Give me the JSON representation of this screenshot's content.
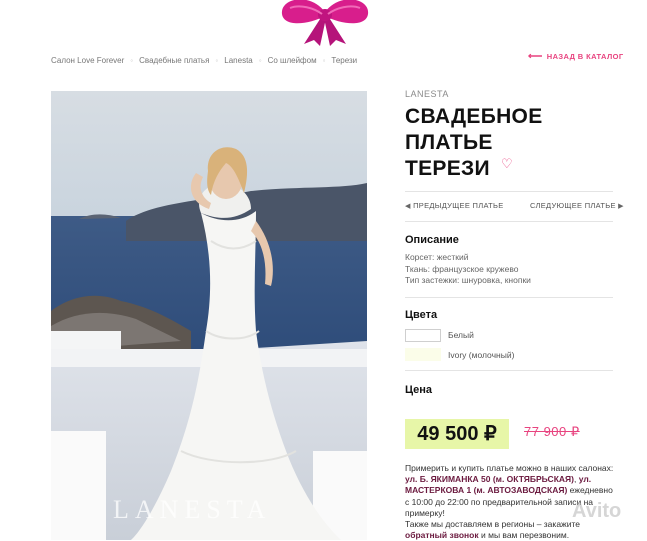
{
  "breadcrumb": {
    "items": [
      "Салон Love Forever",
      "Свадебные платья",
      "Lanesta",
      "Со шлейфом",
      "Терези"
    ]
  },
  "back_link": "НАЗАД В КАТАЛОГ",
  "product": {
    "brand": "LANESTA",
    "title_lines": [
      "СВАДЕБНОЕ",
      "ПЛАТЬЕ",
      "ТЕРЕЗИ"
    ],
    "photo_watermark": "LANESTA"
  },
  "navigation": {
    "prev": "ПРЕДЫДУЩЕЕ ПЛАТЬЕ",
    "next": "СЛЕДУЮЩЕЕ ПЛАТЬЕ"
  },
  "description": {
    "title": "Описание",
    "lines": [
      "Корсет: жесткий",
      "Ткань: французское кружево",
      "Тип застежки: шнуровка, кнопки"
    ]
  },
  "colors": {
    "title": "Цвета",
    "items": [
      {
        "label": "Белый",
        "swatch": "#ffffff"
      },
      {
        "label": "Ivory (молочный)",
        "swatch": "#fbfde9"
      }
    ]
  },
  "price": {
    "title": "Цена",
    "current": "49 500 ₽",
    "old": "77 900 ₽"
  },
  "info": {
    "t1": "Примерить и купить платье можно в наших салонах: ",
    "addr1": "ул. Б. ЯКИМАНКА 50 (м. ОКТЯБРЬСКАЯ)",
    "t2": ", ",
    "addr2": "ул. МАСТЕРКОВА 1 (м. АВТОЗАВОДСКАЯ)",
    "t3": " ежедневно с 10:00 до 22:00 по предварительной записи на примерку!",
    "t4": "Также мы доставляем в регионы – закажите ",
    "callback": "обратный звонок",
    "t5": " и мы вам перезвоним."
  },
  "watermark": "Avito",
  "accent_colors": {
    "pink": "#e8437f",
    "price_highlight": "#e7f6a8"
  }
}
